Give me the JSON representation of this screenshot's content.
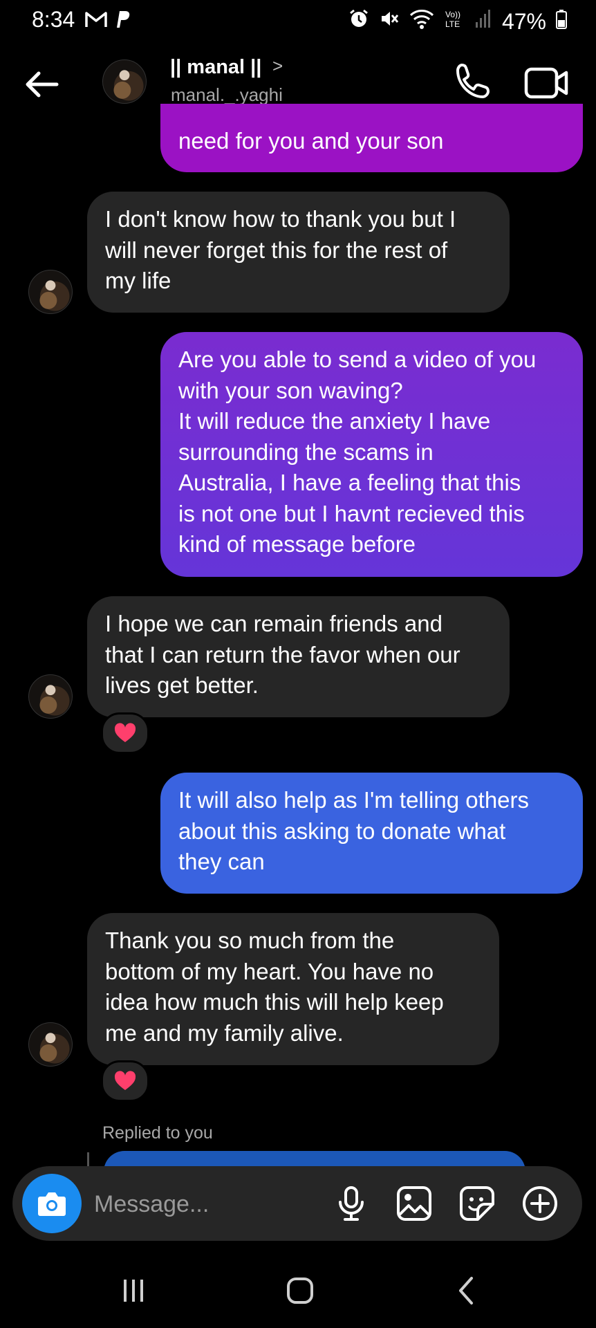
{
  "status_bar": {
    "time": "8:34",
    "battery": "47%",
    "left_icons": [
      "gmail-icon",
      "paypal-icon"
    ],
    "right_icons": [
      "alarm-icon",
      "mute-icon",
      "wifi-icon",
      "volte-icon",
      "signal-icon",
      "battery-icon"
    ]
  },
  "header": {
    "name": "|| manal ||",
    "chevron": ">",
    "username": "manal._.yaghi",
    "buttons": [
      "back-arrow-icon",
      "phone-icon",
      "video-camera-icon"
    ]
  },
  "messages": [
    {
      "direction": "outgoing",
      "text": "need for you and your son",
      "color": "#9b12c4"
    },
    {
      "direction": "incoming",
      "text": "I don't know how to thank you but I\nwill never forget this for the rest of\nmy life",
      "reaction": null
    },
    {
      "direction": "outgoing",
      "text": "Are you able to send a video of you\nwith your son waving?\nIt will reduce the anxiety I have\nsurrounding the scams in\nAustralia, I have a feeling that this\nis not one but I havnt recieved this\nkind of message before",
      "color": "#6d2fd8"
    },
    {
      "direction": "incoming",
      "text": "I hope we can remain friends and\nthat I can return the favor when our\nlives get better.",
      "reaction": "heart-icon"
    },
    {
      "direction": "outgoing",
      "text": "It will also help as I'm telling others\nabout this asking to donate what\nthey can",
      "color": "#3a63e0"
    },
    {
      "direction": "incoming",
      "text": "Thank you so much from the\nbottom of my heart. You have no\nidea how much this will help keep\nme and my family alive.",
      "reaction": "heart-icon"
    }
  ],
  "replied_label": "Replied to you",
  "composer": {
    "placeholder": "Message...",
    "icons": [
      "camera-icon",
      "microphone-icon",
      "gallery-icon",
      "sticker-icon",
      "plus-circle-icon"
    ]
  },
  "nav_bar": {
    "icons": [
      "recent-apps-icon",
      "home-icon",
      "back-icon"
    ]
  },
  "colors": {
    "background": "#000000",
    "incoming_bubble": "#262626",
    "camera_button": "#1a8cf0",
    "reaction_heart": "#ff3f6c"
  }
}
